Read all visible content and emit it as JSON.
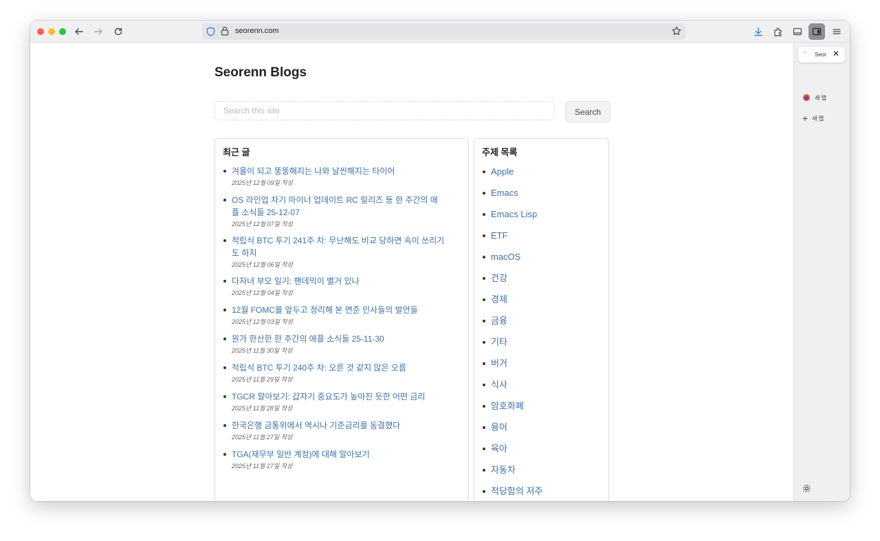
{
  "browser": {
    "url": "seorenn.com",
    "active_tab_title": "Seor",
    "sidebar_tabs": [
      {
        "label": "새 탭"
      },
      {
        "label": "새 탭"
      }
    ]
  },
  "site": {
    "title": "Seorenn Blogs",
    "search_placeholder": "Search this site",
    "search_button": "Search"
  },
  "recent": {
    "title": "최근 글",
    "posts": [
      {
        "title": "겨울이 되고 뚱뚱해지는 나와 날씬해지는 타이어",
        "date": "2025년 12월 09일 작성"
      },
      {
        "title": "OS 라인업 차기 마이너 업데이트 RC 릴리즈 등 한 주간의 애플 소식들 25-12-07",
        "date": "2025년 12월 07일 작성"
      },
      {
        "title": "적립식 BTC 투기 241주 차: 무난해도 비교 당하면 속이 쓰리기도 하지",
        "date": "2025년 12월 06일 작성"
      },
      {
        "title": "다자녀 부모 일기: 팬데믹이 별거 있나",
        "date": "2025년 12월 04일 작성"
      },
      {
        "title": "12월 FOMC를 앞두고 정리해 본 연준 인사들의 발언들",
        "date": "2025년 12월 03일 작성"
      },
      {
        "title": "뭔가 한산한 한 주간의 애플 소식들 25-11-30",
        "date": "2025년 11월 30일 작성"
      },
      {
        "title": "적립식 BTC 투기 240주 차: 오른 것 같지 않은 오름",
        "date": "2025년 11월 29일 작성"
      },
      {
        "title": "TGCR 알아보기: 갑자기 중요도가 높아진 듯한 어떤 금리",
        "date": "2025년 11월 28일 작성"
      },
      {
        "title": "한국은행 금통위에서 역시나 기준금리를 동결했다",
        "date": "2025년 11월 27일 작성"
      },
      {
        "title": "TGA(재무부 일반 계정)에 대해 알아보기",
        "date": "2025년 11월 27일 작성"
      }
    ]
  },
  "topics": {
    "title": "주제 목록",
    "items": [
      "Apple",
      "Emacs",
      "Emacs Lisp",
      "ETF",
      "macOS",
      "건강",
      "경제",
      "금융",
      "기타",
      "버거",
      "식사",
      "암호화폐",
      "용어",
      "육아",
      "자동차",
      "적당함의 저주"
    ]
  },
  "icons": {
    "back": "arrow-left-icon",
    "forward": "arrow-right-icon",
    "reload": "reload-icon",
    "shield": "shield-icon",
    "lock": "lock-icon",
    "star": "star-icon",
    "download": "download-icon",
    "extensions": "puzzle-icon",
    "sidebar": "sidebar-icon",
    "menu": "hamburger-menu-icon",
    "settings": "gear-icon"
  },
  "colors": {
    "link": "#3d6fa8",
    "traffic_close": "#fe5f57",
    "traffic_min": "#febc2e",
    "traffic_max": "#28c840"
  }
}
